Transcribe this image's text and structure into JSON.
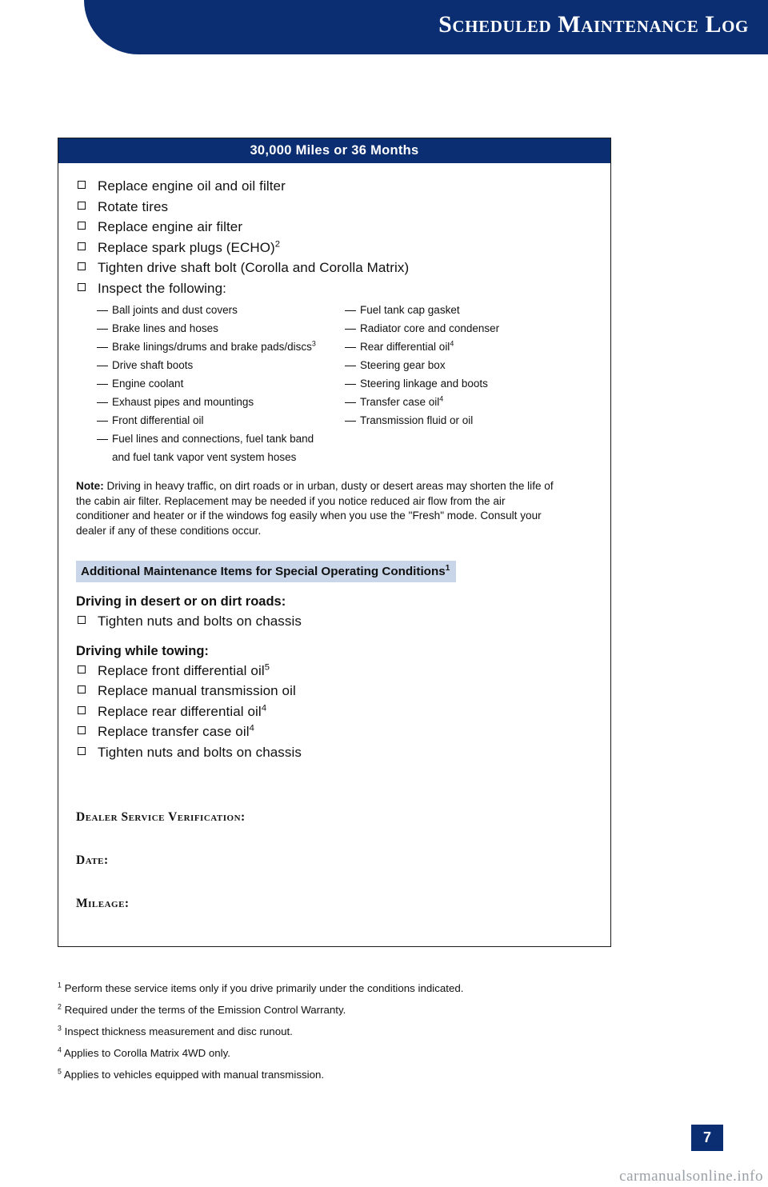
{
  "header": {
    "title": "Scheduled Maintenance Log"
  },
  "box": {
    "title": "30,000 Miles or 36 Months",
    "checklist": [
      {
        "text": "Replace engine oil and oil filter",
        "sup": ""
      },
      {
        "text": "Rotate tires",
        "sup": ""
      },
      {
        "text": "Replace engine air filter",
        "sup": ""
      },
      {
        "text": "Replace spark plugs (ECHO)",
        "sup": "2"
      },
      {
        "text": "Tighten drive shaft bolt (Corolla and Corolla Matrix)",
        "sup": ""
      },
      {
        "text": "Inspect the following:",
        "sup": ""
      }
    ],
    "inspect_left": [
      {
        "text": "Ball joints and dust covers",
        "sup": "",
        "cont": ""
      },
      {
        "text": "Brake lines and hoses",
        "sup": "",
        "cont": ""
      },
      {
        "text": "Brake linings/drums and brake pads/discs",
        "sup": "3",
        "cont": ""
      },
      {
        "text": "Drive shaft boots",
        "sup": "",
        "cont": ""
      },
      {
        "text": "Engine coolant",
        "sup": "",
        "cont": ""
      },
      {
        "text": "Exhaust pipes and mountings",
        "sup": "",
        "cont": ""
      },
      {
        "text": "Front differential oil",
        "sup": "",
        "cont": ""
      },
      {
        "text": "Fuel lines and connections, fuel tank band",
        "sup": "",
        "cont": "and fuel tank vapor vent system hoses"
      }
    ],
    "inspect_right": [
      {
        "text": "Fuel tank cap gasket",
        "sup": "",
        "cont": ""
      },
      {
        "text": "Radiator core and condenser",
        "sup": "",
        "cont": ""
      },
      {
        "text": "Rear differential oil",
        "sup": "4",
        "cont": ""
      },
      {
        "text": "Steering gear box",
        "sup": "",
        "cont": ""
      },
      {
        "text": "Steering linkage and boots",
        "sup": "",
        "cont": ""
      },
      {
        "text": "Transfer case oil",
        "sup": "4",
        "cont": ""
      },
      {
        "text": "Transmission fluid or oil",
        "sup": "",
        "cont": ""
      }
    ],
    "note_label": "Note:",
    "note_text": " Driving in heavy traffic, on dirt roads or in urban, dusty or desert areas may shorten the life of the cabin air filter. Replacement may be needed if you notice reduced air flow from the air conditioner and heater or if the windows fog easily when you use the \"Fresh\" mode. Consult your dealer if any of these conditions occur.",
    "additional_heading": "Additional Maintenance Items for Special Operating Conditions",
    "additional_heading_sup": "1",
    "subhead_desert": "Driving in desert or on dirt roads:",
    "desert_items": [
      {
        "text": "Tighten nuts and bolts on chassis",
        "sup": ""
      }
    ],
    "subhead_towing": "Driving while towing:",
    "towing_items": [
      {
        "text": "Replace front differential oil",
        "sup": "5"
      },
      {
        "text": "Replace manual transmission oil",
        "sup": ""
      },
      {
        "text": "Replace rear differential oil",
        "sup": "4"
      },
      {
        "text": "Replace transfer case oil",
        "sup": "4"
      },
      {
        "text": "Tighten nuts and bolts on chassis",
        "sup": ""
      }
    ],
    "dealer_verification": "Dealer Service Verification:",
    "date_label": "Date:",
    "mileage_label": "Mileage:"
  },
  "footnotes": [
    {
      "sup": "1",
      "text": " Perform these service items only if you drive primarily under the conditions indicated."
    },
    {
      "sup": "2",
      "text": " Required under the terms of the Emission Control Warranty."
    },
    {
      "sup": "3",
      "text": " Inspect thickness measurement and disc runout."
    },
    {
      "sup": "4",
      "text": " Applies to Corolla Matrix 4WD only."
    },
    {
      "sup": "5",
      "text": " Applies to vehicles equipped with manual transmission."
    }
  ],
  "page_number": "7",
  "watermark": "carmanualsonline.info",
  "colors": {
    "navy": "#0b2e72",
    "light_blue": "#c9d5e8"
  }
}
